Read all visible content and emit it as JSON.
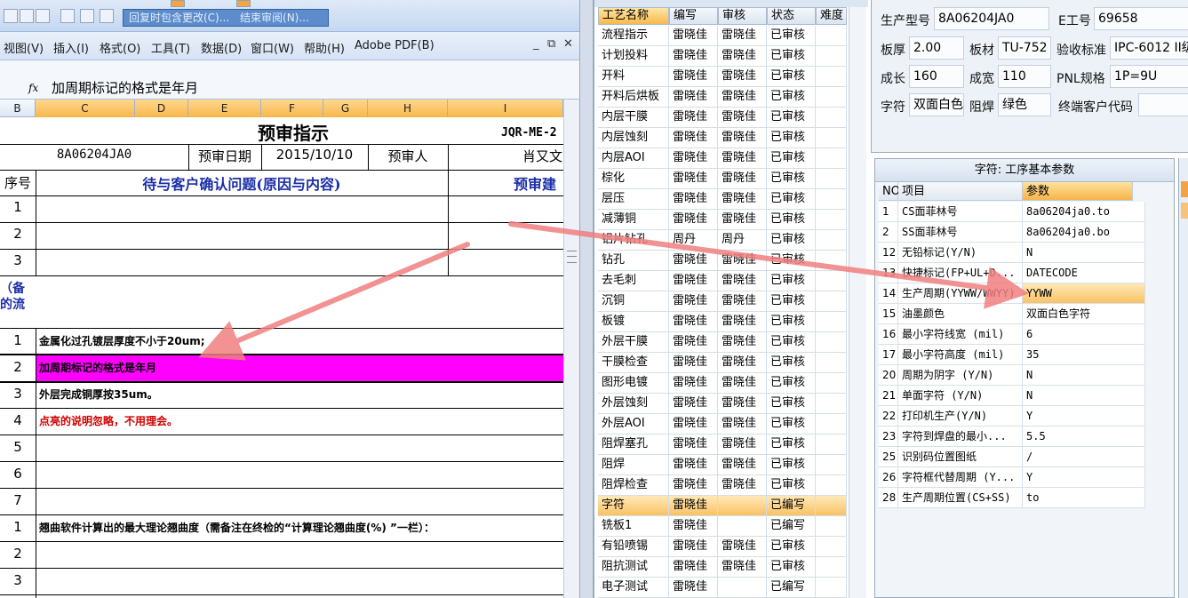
{
  "excel": {
    "review_bar": [
      "回复时包含更改(C)...",
      "结束审阅(N)..."
    ],
    "menus": [
      "视图(V)",
      "插入(I)",
      "格式(O)",
      "工具(T)",
      "数据(D)",
      "窗口(W)",
      "帮助(H)",
      "Adobe PDF(B)"
    ],
    "formula": {
      "fx": "fx",
      "text": "加周期标记的格式是年月"
    },
    "columns": [
      "B",
      "C",
      "D",
      "E",
      "F",
      "G",
      "H",
      "I"
    ],
    "sheet": {
      "title": "预审指示",
      "code": "JQR-ME-2",
      "model": "8A06204JA0",
      "date_label": "预审日期",
      "date": "2015/10/10",
      "reviewer_label": "预审人",
      "reviewer": "肖又文",
      "seq_header": "序号",
      "issue_header": "待与客户确认问题(原因与内容)",
      "suggest_header": "预审建",
      "note_line1": "（备",
      "note_line2": "的流",
      "top_rows": [
        "1",
        "2",
        "3"
      ],
      "notes": [
        {
          "no": "1",
          "text": "金属化过孔镀层厚度不小于20um;"
        },
        {
          "no": "2",
          "text": "加周期标记的格式是年月"
        },
        {
          "no": "3",
          "text": "外层完成铜厚按35um。"
        },
        {
          "no": "4",
          "text": "点亮的说明忽略，不用理会。"
        },
        {
          "no": "5",
          "text": ""
        },
        {
          "no": "6",
          "text": ""
        },
        {
          "no": "7",
          "text": ""
        }
      ],
      "warp_text": "翘曲软件计算出的最大理论翘曲度（需备注在终检的“计算理论翘曲度(%) ”一栏）：",
      "warp_rows": [
        "1",
        "2",
        "3"
      ]
    }
  },
  "process": {
    "headers": [
      "工艺名称",
      "编写",
      "审核",
      "状态",
      "难度"
    ],
    "rows": [
      {
        "name": "流程指示",
        "writer": "雷晓佳",
        "reviewer": "雷晓佳",
        "status": "已审核"
      },
      {
        "name": "计划投料",
        "writer": "雷晓佳",
        "reviewer": "雷晓佳",
        "status": "已审核"
      },
      {
        "name": "开料",
        "writer": "雷晓佳",
        "reviewer": "雷晓佳",
        "status": "已审核"
      },
      {
        "name": "开料后烘板",
        "writer": "雷晓佳",
        "reviewer": "雷晓佳",
        "status": "已审核"
      },
      {
        "name": "内层干膜",
        "writer": "雷晓佳",
        "reviewer": "雷晓佳",
        "status": "已审核"
      },
      {
        "name": "内层蚀刻",
        "writer": "雷晓佳",
        "reviewer": "雷晓佳",
        "status": "已审核"
      },
      {
        "name": "内层AOI",
        "writer": "雷晓佳",
        "reviewer": "雷晓佳",
        "status": "已审核"
      },
      {
        "name": "棕化",
        "writer": "雷晓佳",
        "reviewer": "雷晓佳",
        "status": "已审核"
      },
      {
        "name": "层压",
        "writer": "雷晓佳",
        "reviewer": "雷晓佳",
        "status": "已审核"
      },
      {
        "name": "减薄铜",
        "writer": "雷晓佳",
        "reviewer": "雷晓佳",
        "status": "已审核"
      },
      {
        "name": "铝片钻孔",
        "writer": "周丹",
        "reviewer": "周丹",
        "status": "已审核"
      },
      {
        "name": "钻孔",
        "writer": "雷晓佳",
        "reviewer": "雷晓佳",
        "status": "已审核"
      },
      {
        "name": "去毛刺",
        "writer": "雷晓佳",
        "reviewer": "雷晓佳",
        "status": "已审核"
      },
      {
        "name": "沉铜",
        "writer": "雷晓佳",
        "reviewer": "雷晓佳",
        "status": "已审核"
      },
      {
        "name": "板镀",
        "writer": "雷晓佳",
        "reviewer": "雷晓佳",
        "status": "已审核"
      },
      {
        "name": "外层干膜",
        "writer": "雷晓佳",
        "reviewer": "雷晓佳",
        "status": "已审核"
      },
      {
        "name": "干膜检查",
        "writer": "雷晓佳",
        "reviewer": "雷晓佳",
        "status": "已审核"
      },
      {
        "name": "图形电镀",
        "writer": "雷晓佳",
        "reviewer": "雷晓佳",
        "status": "已审核"
      },
      {
        "name": "外层蚀刻",
        "writer": "雷晓佳",
        "reviewer": "雷晓佳",
        "status": "已审核"
      },
      {
        "name": "外层AOI",
        "writer": "雷晓佳",
        "reviewer": "雷晓佳",
        "status": "已审核"
      },
      {
        "name": "阻焊塞孔",
        "writer": "雷晓佳",
        "reviewer": "雷晓佳",
        "status": "已审核"
      },
      {
        "name": "阻焊",
        "writer": "雷晓佳",
        "reviewer": "雷晓佳",
        "status": "已审核"
      },
      {
        "name": "阻焊检查",
        "writer": "雷晓佳",
        "reviewer": "雷晓佳",
        "status": "已审核"
      },
      {
        "name": "字符",
        "writer": "雷晓佳",
        "reviewer": "",
        "status": "已编写"
      },
      {
        "name": "铣板1",
        "writer": "雷晓佳",
        "reviewer": "",
        "status": "已编写"
      },
      {
        "name": "有铅喷锡",
        "writer": "雷晓佳",
        "reviewer": "雷晓佳",
        "status": "已审核"
      },
      {
        "name": "阻抗测试",
        "writer": "雷晓佳",
        "reviewer": "雷晓佳",
        "status": "已审核"
      },
      {
        "name": "电子测试",
        "writer": "雷晓佳",
        "reviewer": "",
        "status": "已编写"
      }
    ]
  },
  "info": {
    "model_label": "生产型号",
    "model": "8A06204JA0",
    "eno_label": "E工号",
    "eno": "69658",
    "thickness_label": "板厚",
    "thickness": "2.00",
    "material_label": "板材",
    "material": "TU-752",
    "standard_label": "验收标准",
    "standard": "IPC-6012 II级",
    "length_label": "成长",
    "length": "160",
    "width_label": "成宽",
    "width": "110",
    "pnl_label": "PNL规格",
    "pnl": "1P=9U",
    "char_label": "字符",
    "char": "双面白色",
    "mask_label": "阻焊",
    "mask": "绿色",
    "customer_code_label": "终端客户代码",
    "customer_code": ""
  },
  "params": {
    "title": "字符: 工序基本参数",
    "headers": [
      "NO",
      "项目",
      "参数"
    ],
    "rows": [
      {
        "no": "1",
        "item": "CS面菲林号",
        "value": "8a06204ja0.to"
      },
      {
        "no": "2",
        "item": "SS面菲林号",
        "value": "8a06204ja0.bo"
      },
      {
        "no": "12",
        "item": "无铅标记(Y/N)",
        "value": "N"
      },
      {
        "no": "13",
        "item": "快捷标记(FP+UL+D...",
        "value": "DATECODE"
      },
      {
        "no": "14",
        "item": "生产周期(YYWW/WWYY)",
        "value": "YYWW"
      },
      {
        "no": "15",
        "item": "油墨颜色",
        "value": "双面白色字符"
      },
      {
        "no": "16",
        "item": "最小字符线宽 (mil)",
        "value": "6"
      },
      {
        "no": "17",
        "item": "最小字符高度 (mil)",
        "value": "35"
      },
      {
        "no": "20",
        "item": "周期为阴字 (Y/N)",
        "value": "N"
      },
      {
        "no": "21",
        "item": "单面字符 (Y/N)",
        "value": "N"
      },
      {
        "no": "22",
        "item": "打印机生产(Y/N)",
        "value": "Y"
      },
      {
        "no": "23",
        "item": "字符到焊盘的最小...",
        "value": "5.5"
      },
      {
        "no": "25",
        "item": "识别码位置图纸",
        "value": "/"
      },
      {
        "no": "26",
        "item": "字符框代替周期 (Y...",
        "value": "Y"
      },
      {
        "no": "28",
        "item": "生产周期位置(CS+SS)",
        "value": "to"
      }
    ]
  },
  "colors": {
    "highlight_magenta": "#ff00ff",
    "header_blue": "#1b2fa8",
    "note_red": "#d00000",
    "selected_orange": "#f7b94b",
    "arrow": "#f08080"
  }
}
